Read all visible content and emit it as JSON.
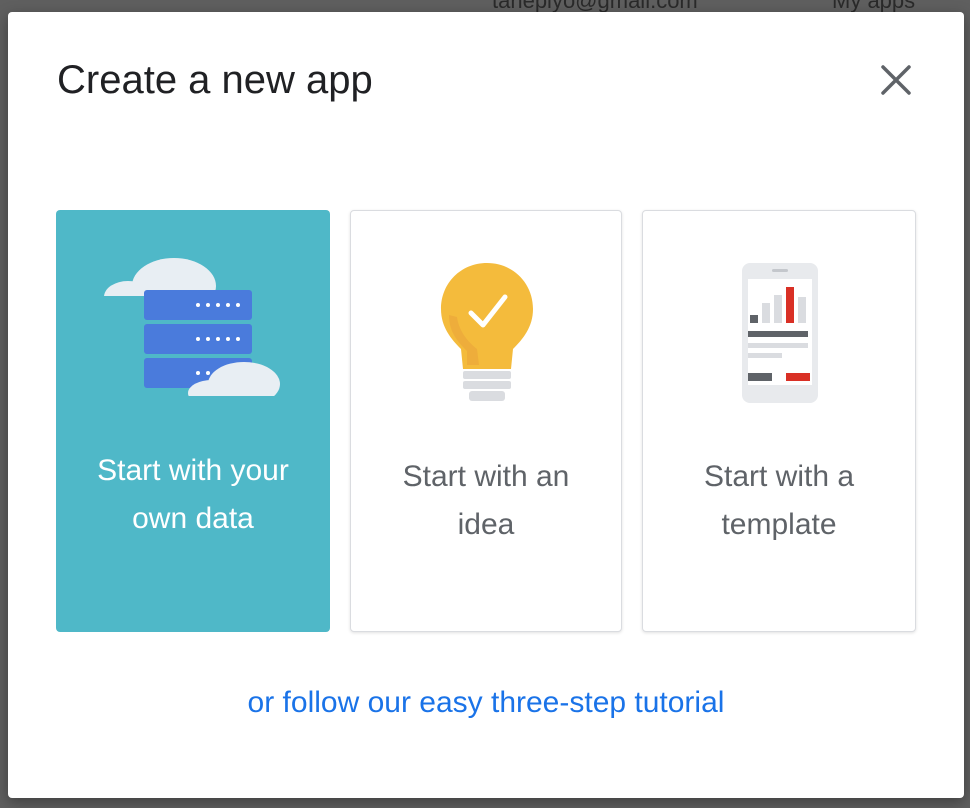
{
  "background": {
    "email": "tanepiyo@gmail.com",
    "my_apps": "My apps"
  },
  "dialog": {
    "title": "Create a new app",
    "close_icon": "close-icon",
    "options": [
      {
        "label": "Start with your own data",
        "icon": "cloud-database-icon",
        "selected": true
      },
      {
        "label": "Start with an idea",
        "icon": "lightbulb-icon",
        "selected": false
      },
      {
        "label": "Start with a template",
        "icon": "phone-template-icon",
        "selected": false
      }
    ],
    "tutorial_link": "or follow our easy three-step tutorial"
  },
  "colors": {
    "selected_card": "#4fb8c8",
    "link": "#1a73e8",
    "bulb": "#f4bb3c",
    "server": "#4a7bdc",
    "bar_red": "#d93025"
  }
}
